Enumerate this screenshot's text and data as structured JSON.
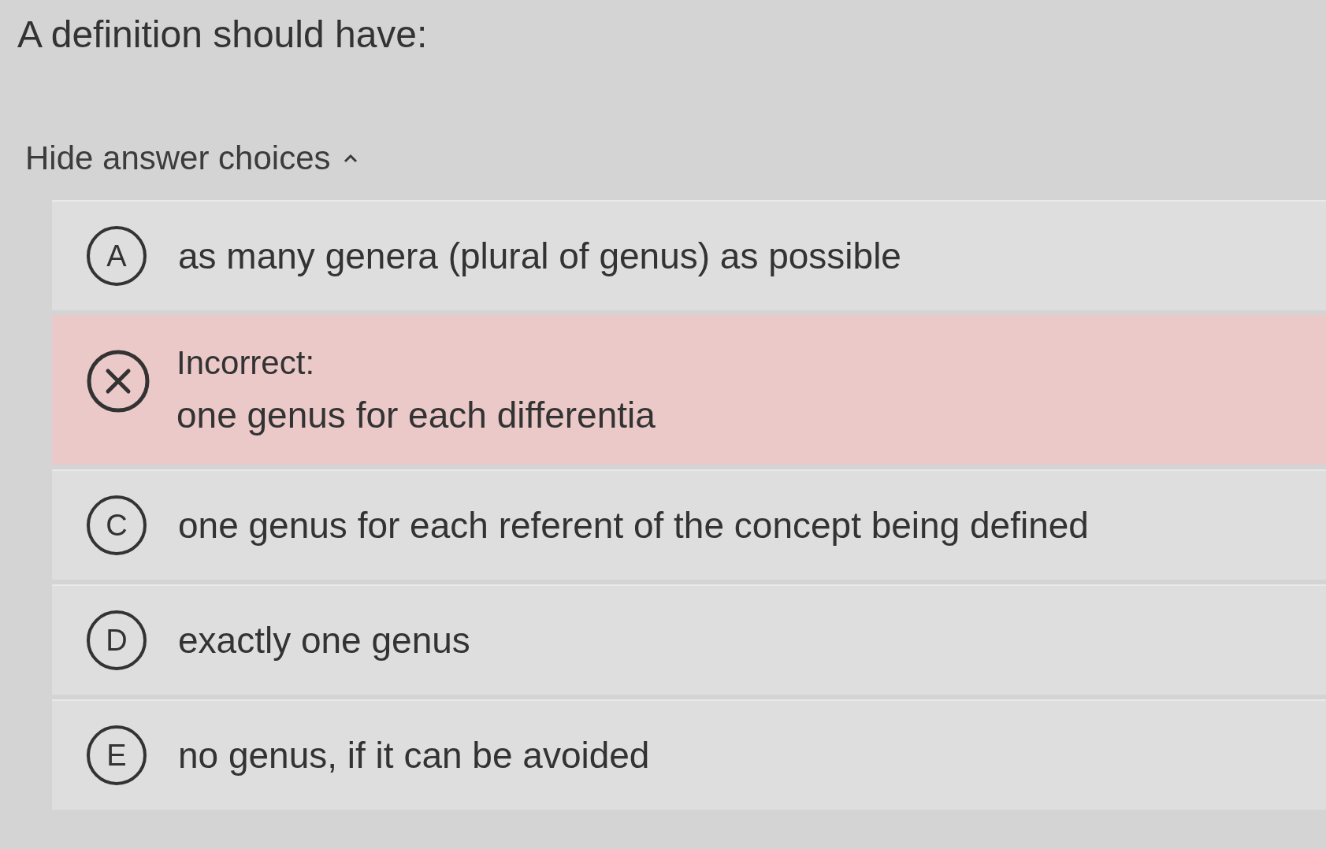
{
  "question": "A definition should have:",
  "toggle": {
    "label": "Hide answer choices",
    "expanded": true
  },
  "choices": [
    {
      "letter": "A",
      "text": "as many genera (plural of genus) as possible",
      "selected": false
    },
    {
      "feedback": "Incorrect:",
      "text": "one genus for each differentia",
      "selected": true
    },
    {
      "letter": "C",
      "text": "one genus for each referent of the concept being defined",
      "selected": false
    },
    {
      "letter": "D",
      "text": "exactly one genus",
      "selected": false
    },
    {
      "letter": "E",
      "text": "no genus, if it can be avoided",
      "selected": false
    }
  ]
}
